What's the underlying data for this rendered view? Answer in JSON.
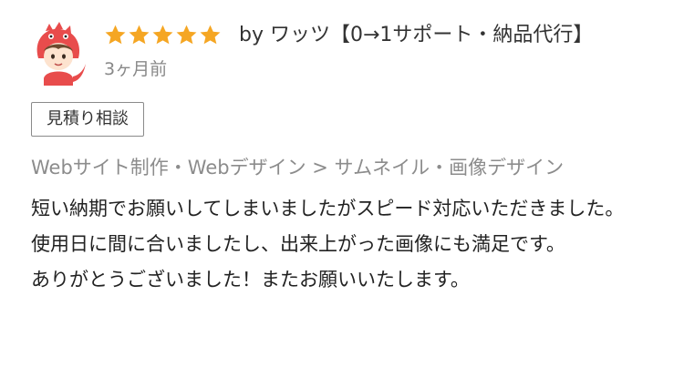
{
  "review": {
    "rating": 5,
    "rating_max": 5,
    "reviewer_prefix": "by",
    "reviewer_name": "ワッツ【0→1サポート・納品代行】",
    "time_ago": "3ヶ月前",
    "estimate_label": "見積り相談",
    "category_path": "Webサイト制作・Webデザイン > サムネイル・画像デザイン",
    "body": {
      "line1": "短い納期でお願いしてしまいましたがスピード対応いただきました。",
      "line2": "使用日に間に合いましたし、出来上がった画像にも満足です。",
      "line3": "ありがとうございました！またお願いいたします。"
    }
  },
  "colors": {
    "star": "#f5a623",
    "avatar_hat": "#e84c4c",
    "muted_text": "#888888"
  },
  "icons": {
    "avatar": "dinosaur-hood-character-avatar",
    "star": "star-icon"
  }
}
